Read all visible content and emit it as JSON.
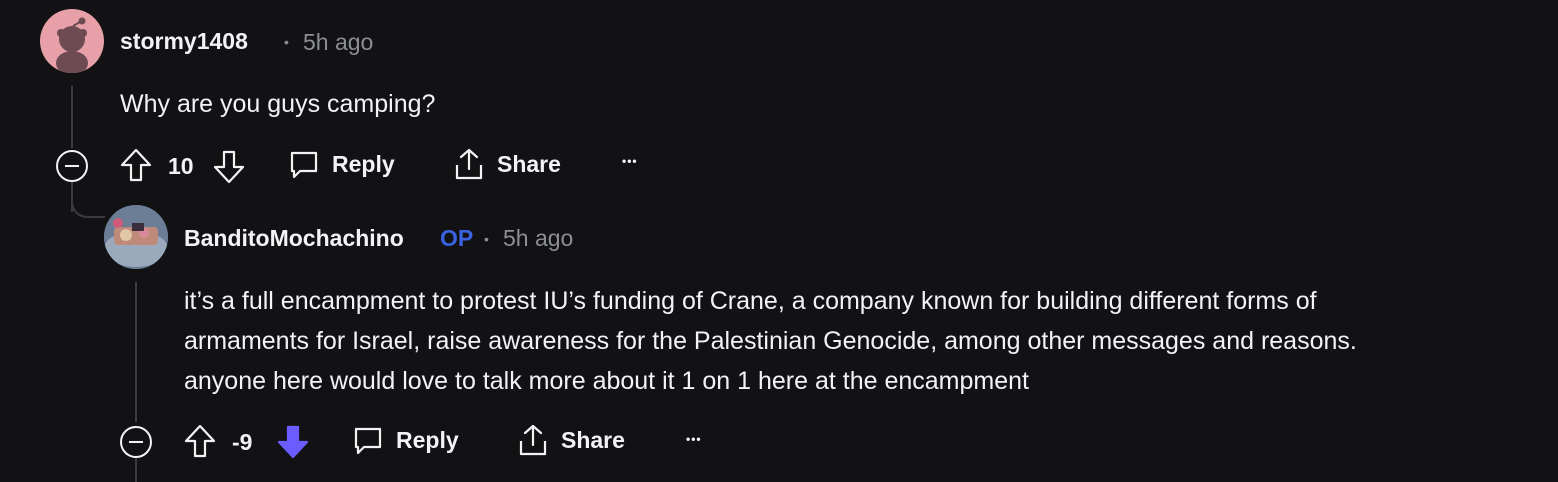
{
  "comments": [
    {
      "username": "stormy1408",
      "separator": "•",
      "time": "5h ago",
      "body": "Why are you guys camping?",
      "score": "10",
      "actions": {
        "reply": "Reply",
        "share": "Share",
        "more": "•••"
      },
      "downvoted": false
    },
    {
      "username": "BanditoMochachino",
      "op_badge": "OP",
      "separator": "•",
      "time": "5h ago",
      "body_lines": [
        "it’s a full encampment to protest IU’s funding of Crane, a company known for building different forms of",
        "armaments for Israel, raise awareness for the Palestinian Genocide, among other messages and reasons.",
        "anyone here would love to talk more about it 1 on 1 here at the encampment"
      ],
      "score": "-9",
      "actions": {
        "reply": "Reply",
        "share": "Share",
        "more": "•••"
      },
      "downvoted": true
    }
  ],
  "colors": {
    "background": "#121214",
    "text": "#f2f3f5",
    "muted": "#8b8f94",
    "op_badge": "#3b62e0",
    "downvote_active": "#6a5cff",
    "thread_line": "#3a3c40"
  }
}
